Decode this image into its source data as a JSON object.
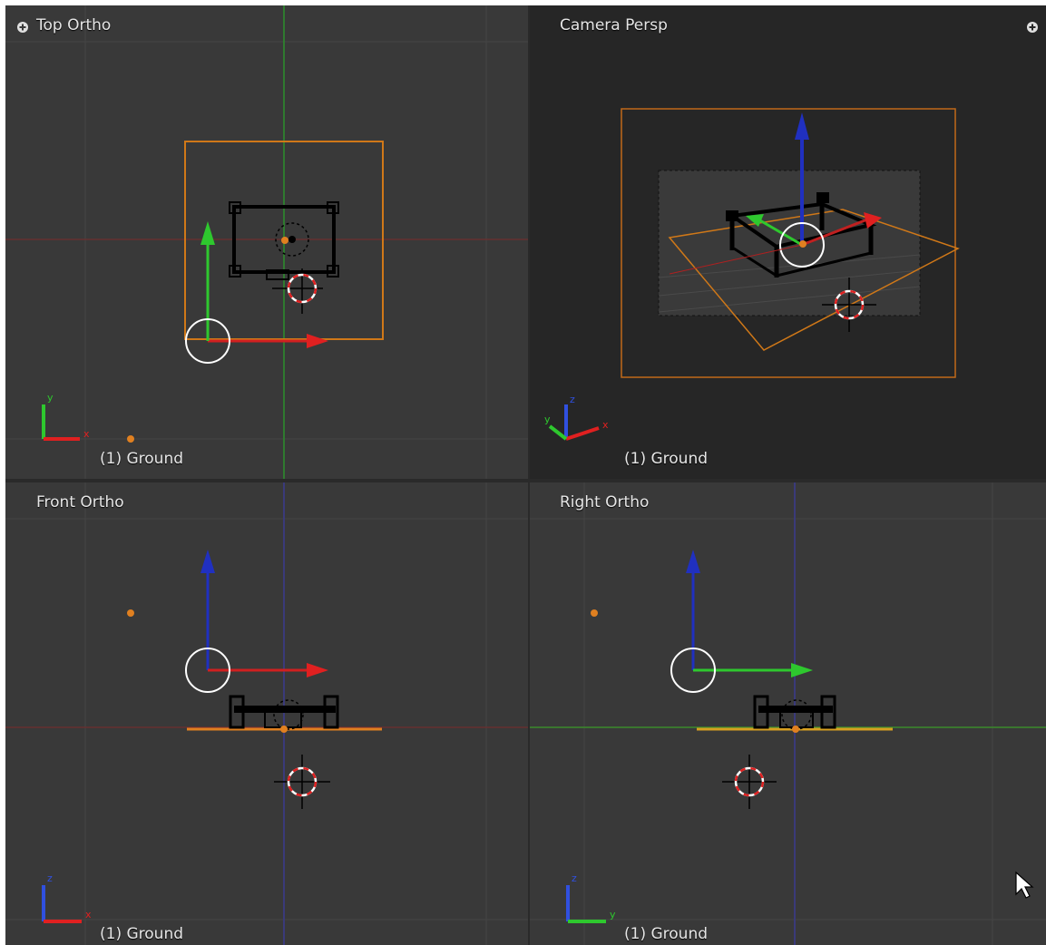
{
  "viewports": [
    {
      "title": "Top Ortho",
      "footer": "(1) Ground",
      "axes": [
        "y",
        "x"
      ]
    },
    {
      "title": "Camera Persp",
      "footer": "(1) Ground",
      "axes": [
        "z",
        "y",
        "x"
      ]
    },
    {
      "title": "Front Ortho",
      "footer": "(1) Ground",
      "axes": [
        "z",
        "x"
      ]
    },
    {
      "title": "Right Ortho",
      "footer": "(1) Ground",
      "axes": [
        "z",
        "y"
      ]
    }
  ],
  "colors": {
    "viewport_bg": "#393939",
    "camera_bg": "#262626",
    "grid": "#454545",
    "x_axis": "#e02020",
    "y_axis": "#2ec82e",
    "z_axis": "#3050e0",
    "selection": "#e08020"
  },
  "icons": [
    "view-toggle-icon",
    "cursor-pointer-icon",
    "3d-cursor-icon",
    "axis-gizmo-icon"
  ]
}
